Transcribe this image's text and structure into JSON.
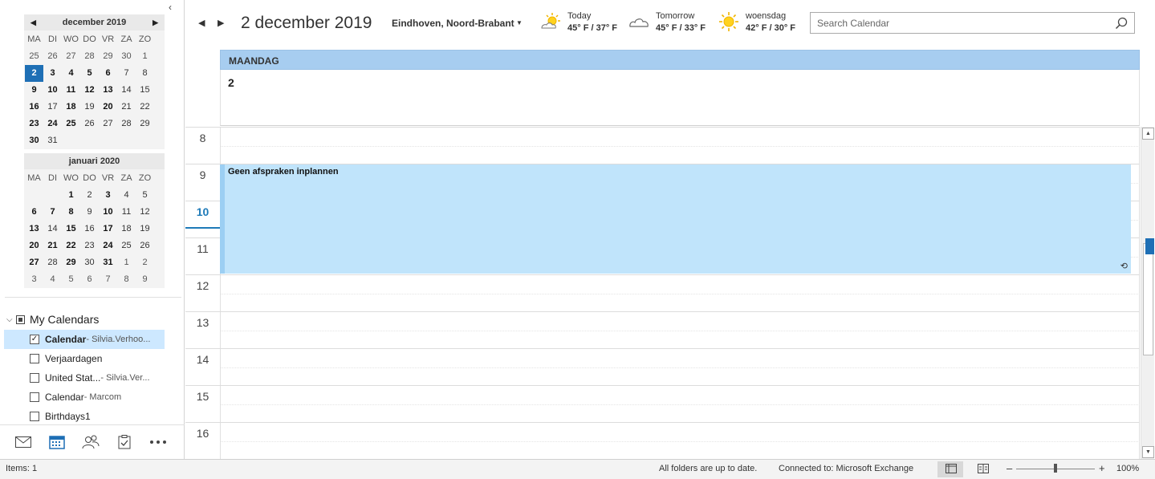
{
  "left": {
    "collapse_glyph": "‹",
    "cal1": {
      "title": "december 2019",
      "dows": [
        "MA",
        "DI",
        "WO",
        "DO",
        "VR",
        "ZA",
        "ZO"
      ],
      "days": [
        {
          "d": "25",
          "t": "o"
        },
        {
          "d": "26",
          "t": "o"
        },
        {
          "d": "27",
          "t": "o"
        },
        {
          "d": "28",
          "t": "o"
        },
        {
          "d": "29",
          "t": "o"
        },
        {
          "d": "30",
          "t": "o"
        },
        {
          "d": "1",
          "t": "o"
        },
        {
          "d": "2",
          "t": "sel"
        },
        {
          "d": "3",
          "t": "b"
        },
        {
          "d": "4",
          "t": "b"
        },
        {
          "d": "5",
          "t": "b"
        },
        {
          "d": "6",
          "t": "b"
        },
        {
          "d": "7",
          "t": ""
        },
        {
          "d": "8",
          "t": ""
        },
        {
          "d": "9",
          "t": "b"
        },
        {
          "d": "10",
          "t": "b"
        },
        {
          "d": "11",
          "t": "b"
        },
        {
          "d": "12",
          "t": "b"
        },
        {
          "d": "13",
          "t": "b"
        },
        {
          "d": "14",
          "t": ""
        },
        {
          "d": "15",
          "t": ""
        },
        {
          "d": "16",
          "t": "b"
        },
        {
          "d": "17",
          "t": ""
        },
        {
          "d": "18",
          "t": "b"
        },
        {
          "d": "19",
          "t": ""
        },
        {
          "d": "20",
          "t": "b"
        },
        {
          "d": "21",
          "t": ""
        },
        {
          "d": "22",
          "t": ""
        },
        {
          "d": "23",
          "t": "b"
        },
        {
          "d": "24",
          "t": "b"
        },
        {
          "d": "25",
          "t": "b"
        },
        {
          "d": "26",
          "t": ""
        },
        {
          "d": "27",
          "t": ""
        },
        {
          "d": "28",
          "t": ""
        },
        {
          "d": "29",
          "t": ""
        },
        {
          "d": "30",
          "t": "b"
        },
        {
          "d": "31",
          "t": ""
        }
      ]
    },
    "cal2": {
      "title": "januari 2020",
      "dows": [
        "MA",
        "DI",
        "WO",
        "DO",
        "VR",
        "ZA",
        "ZO"
      ],
      "days": [
        {
          "d": "",
          "t": ""
        },
        {
          "d": "",
          "t": ""
        },
        {
          "d": "1",
          "t": "b"
        },
        {
          "d": "2",
          "t": ""
        },
        {
          "d": "3",
          "t": "b"
        },
        {
          "d": "4",
          "t": ""
        },
        {
          "d": "5",
          "t": ""
        },
        {
          "d": "6",
          "t": "b"
        },
        {
          "d": "7",
          "t": "b"
        },
        {
          "d": "8",
          "t": "b"
        },
        {
          "d": "9",
          "t": ""
        },
        {
          "d": "10",
          "t": "b"
        },
        {
          "d": "11",
          "t": ""
        },
        {
          "d": "12",
          "t": ""
        },
        {
          "d": "13",
          "t": "b"
        },
        {
          "d": "14",
          "t": ""
        },
        {
          "d": "15",
          "t": "b"
        },
        {
          "d": "16",
          "t": ""
        },
        {
          "d": "17",
          "t": "b"
        },
        {
          "d": "18",
          "t": ""
        },
        {
          "d": "19",
          "t": ""
        },
        {
          "d": "20",
          "t": "b"
        },
        {
          "d": "21",
          "t": "b"
        },
        {
          "d": "22",
          "t": "b"
        },
        {
          "d": "23",
          "t": ""
        },
        {
          "d": "24",
          "t": "b"
        },
        {
          "d": "25",
          "t": ""
        },
        {
          "d": "26",
          "t": ""
        },
        {
          "d": "27",
          "t": "b"
        },
        {
          "d": "28",
          "t": ""
        },
        {
          "d": "29",
          "t": "b"
        },
        {
          "d": "30",
          "t": ""
        },
        {
          "d": "31",
          "t": "b"
        },
        {
          "d": "1",
          "t": "o"
        },
        {
          "d": "2",
          "t": "o"
        },
        {
          "d": "3",
          "t": "o"
        },
        {
          "d": "4",
          "t": "o"
        },
        {
          "d": "5",
          "t": "o"
        },
        {
          "d": "6",
          "t": "o"
        },
        {
          "d": "7",
          "t": "o"
        },
        {
          "d": "8",
          "t": "o"
        },
        {
          "d": "9",
          "t": "o"
        }
      ]
    },
    "my_calendars": {
      "title": "My Calendars",
      "items": [
        {
          "name": "Calendar",
          "owner": " - Silvia.Verhoo...",
          "checked": true,
          "active": true
        },
        {
          "name": "Verjaardagen",
          "owner": "",
          "checked": false,
          "active": false
        },
        {
          "name": "United Stat...",
          "owner": " - Silvia.Ver...",
          "checked": false,
          "active": false
        },
        {
          "name": "Calendar",
          "owner": " - Marcom",
          "checked": false,
          "active": false
        },
        {
          "name": "Birthdays1",
          "owner": "",
          "checked": false,
          "active": false
        }
      ]
    },
    "nav": [
      "mail-icon",
      "calendar-icon",
      "people-icon",
      "tasks-icon",
      "more-icon"
    ]
  },
  "toolbar": {
    "prev_glyph": "◀",
    "next_glyph": "▶",
    "date_title": "2 december 2019",
    "location": "Eindhoven, Noord-Brabant",
    "location_dd": "▼",
    "weather": [
      {
        "label": "Today",
        "temp": "45° F / 37° F",
        "icon": "partly-sunny"
      },
      {
        "label": "Tomorrow",
        "temp": "45° F / 33° F",
        "icon": "cloudy"
      },
      {
        "label": "woensdag",
        "temp": "42° F / 30° F",
        "icon": "sunny"
      }
    ],
    "search_placeholder": "Search Calendar"
  },
  "day": {
    "header": "MAANDAG",
    "number": "2",
    "hours": [
      "8",
      "9",
      "10",
      "11",
      "12",
      "13",
      "14",
      "15",
      "16"
    ],
    "current_hour": "10",
    "event": {
      "title": "Geen afspraken inplannen",
      "recurring_glyph": "⟲"
    }
  },
  "status": {
    "items": "Items: 1",
    "uptodate": "All folders are up to date.",
    "connected": "Connected to: Microsoft Exchange",
    "zoom_minus": "–",
    "zoom_plus": "+",
    "zoom": "100%"
  },
  "colors": {
    "accent": "#1e6fb5",
    "event_bg": "#c0e4fb",
    "header_bg": "#a7cdf0"
  }
}
